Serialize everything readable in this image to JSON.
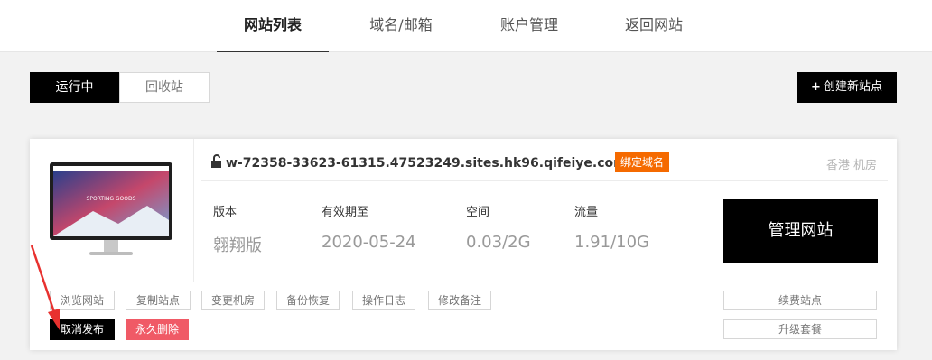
{
  "nav": {
    "tabs": [
      {
        "label": "网站列表",
        "active": true
      },
      {
        "label": "域名/邮箱",
        "active": false
      },
      {
        "label": "账户管理",
        "active": false
      },
      {
        "label": "返回网站",
        "active": false
      }
    ]
  },
  "toolbar": {
    "running_label": "运行中",
    "recycle_label": "回收站",
    "create_label": "创建新站点"
  },
  "site": {
    "domain": "w-72358-33623-61315.47523249.sites.hk96.qifeiye.com",
    "bind_domain_label": "绑定域名",
    "location": "香港 机房",
    "thumbnail_caption": "SPORTING GOODS",
    "stats": [
      {
        "label": "版本",
        "value": "翱翔版"
      },
      {
        "label": "有效期至",
        "value": "2020-05-24"
      },
      {
        "label": "空间",
        "value": "0.03/2G"
      },
      {
        "label": "流量",
        "value": "1.91/10G"
      }
    ],
    "manage_label": "管理网站",
    "actions": [
      "浏览网站",
      "复制站点",
      "变更机房",
      "备份恢复",
      "操作日志",
      "修改备注"
    ],
    "renew_label": "续费站点",
    "upgrade_label": "升级套餐",
    "unpublish_label": "取消发布",
    "delete_label": "永久删除"
  },
  "colors": {
    "badge": "#f56a00",
    "delete": "#f05a66",
    "arrow": "#e8312f"
  }
}
